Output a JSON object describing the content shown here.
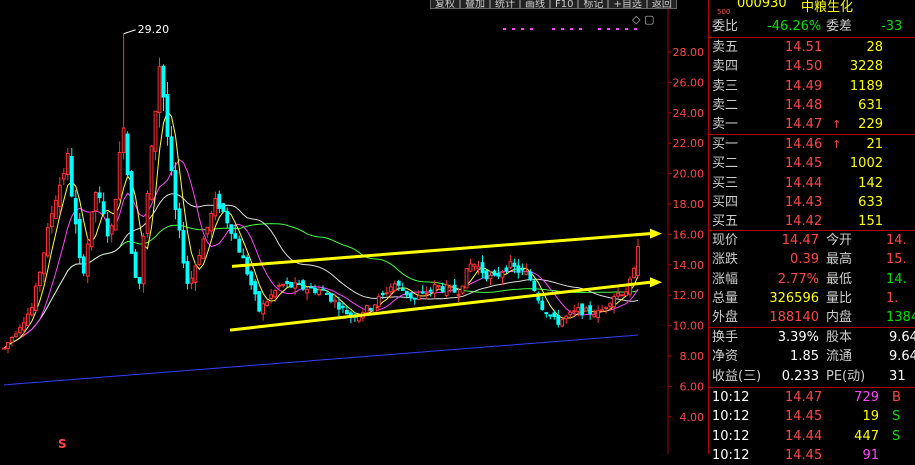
{
  "toolbar": {
    "buttons": [
      "复权",
      "叠加",
      "统计",
      "画线",
      "F10",
      "标记",
      "+自选",
      "返回"
    ]
  },
  "chart": {
    "high_label": "29.20",
    "y_ticks": [
      "28.00",
      "26.00",
      "24.00",
      "22.00",
      "20.00",
      "18.00",
      "16.00",
      "14.00",
      "12.00",
      "10.00",
      "8.00",
      "6.00",
      "4.00"
    ],
    "marker": "S"
  },
  "stock": {
    "small_label": "500",
    "code": "000930",
    "name": "中粮生化"
  },
  "commission": {
    "ratio_label": "委比",
    "ratio_value": "-46.26%",
    "diff_label": "委差",
    "diff_value": "-33"
  },
  "sell_orders": [
    {
      "label": "卖五",
      "price": "14.51",
      "volume": "28",
      "arrow": ""
    },
    {
      "label": "卖四",
      "price": "14.50",
      "volume": "3228",
      "arrow": ""
    },
    {
      "label": "卖三",
      "price": "14.49",
      "volume": "1189",
      "arrow": ""
    },
    {
      "label": "卖二",
      "price": "14.48",
      "volume": "631",
      "arrow": ""
    },
    {
      "label": "卖一",
      "price": "14.47",
      "volume": "229",
      "arrow": "↑"
    }
  ],
  "buy_orders": [
    {
      "label": "买一",
      "price": "14.46",
      "volume": "21",
      "arrow": "↑"
    },
    {
      "label": "买二",
      "price": "14.45",
      "volume": "1002",
      "arrow": ""
    },
    {
      "label": "买三",
      "price": "14.44",
      "volume": "142",
      "arrow": ""
    },
    {
      "label": "买四",
      "price": "14.43",
      "volume": "633",
      "arrow": ""
    },
    {
      "label": "买五",
      "price": "14.42",
      "volume": "151",
      "arrow": ""
    }
  ],
  "quote": [
    {
      "l1": "现价",
      "v1": "14.47",
      "l2": "今开",
      "v2": "14."
    },
    {
      "l1": "涨跌",
      "v1": "0.39",
      "l2": "最高",
      "v2": "15."
    },
    {
      "l1": "涨幅",
      "v1": "2.77%",
      "l2": "最低",
      "v2": "14."
    },
    {
      "l1": "总量",
      "v1": "326596",
      "l2": "量比",
      "v2": "1."
    },
    {
      "l1": "外盘",
      "v1": "188140",
      "l2": "内盘",
      "v2": "1384"
    }
  ],
  "fundamentals": [
    {
      "l1": "换手",
      "v1": "3.39%",
      "l2": "股本",
      "v2": "9.64"
    },
    {
      "l1": "净资",
      "v1": "1.85",
      "l2": "流通",
      "v2": "9.64"
    },
    {
      "l1": "收益(三)",
      "v1": "0.233",
      "l2": "PE(动)",
      "v2": "31"
    }
  ],
  "ticks": [
    {
      "time": "10:12",
      "price": "14.47",
      "vol": "729",
      "side": "B"
    },
    {
      "time": "10:12",
      "price": "14.45",
      "vol": "19",
      "side": "S"
    },
    {
      "time": "10:12",
      "price": "14.44",
      "vol": "447",
      "side": "S"
    },
    {
      "time": "10:12",
      "price": "14.45",
      "vol": "91",
      "side": ""
    }
  ],
  "colors": {
    "up": "#ff3333",
    "down": "#00ffff",
    "trendline": "#ffff00",
    "ma_white": "#e8e8e8",
    "ma_yellow": "#ffff40",
    "ma_magenta": "#ff40ff",
    "ma_green": "#40ff40",
    "ma_blue": "#3040ff"
  }
}
